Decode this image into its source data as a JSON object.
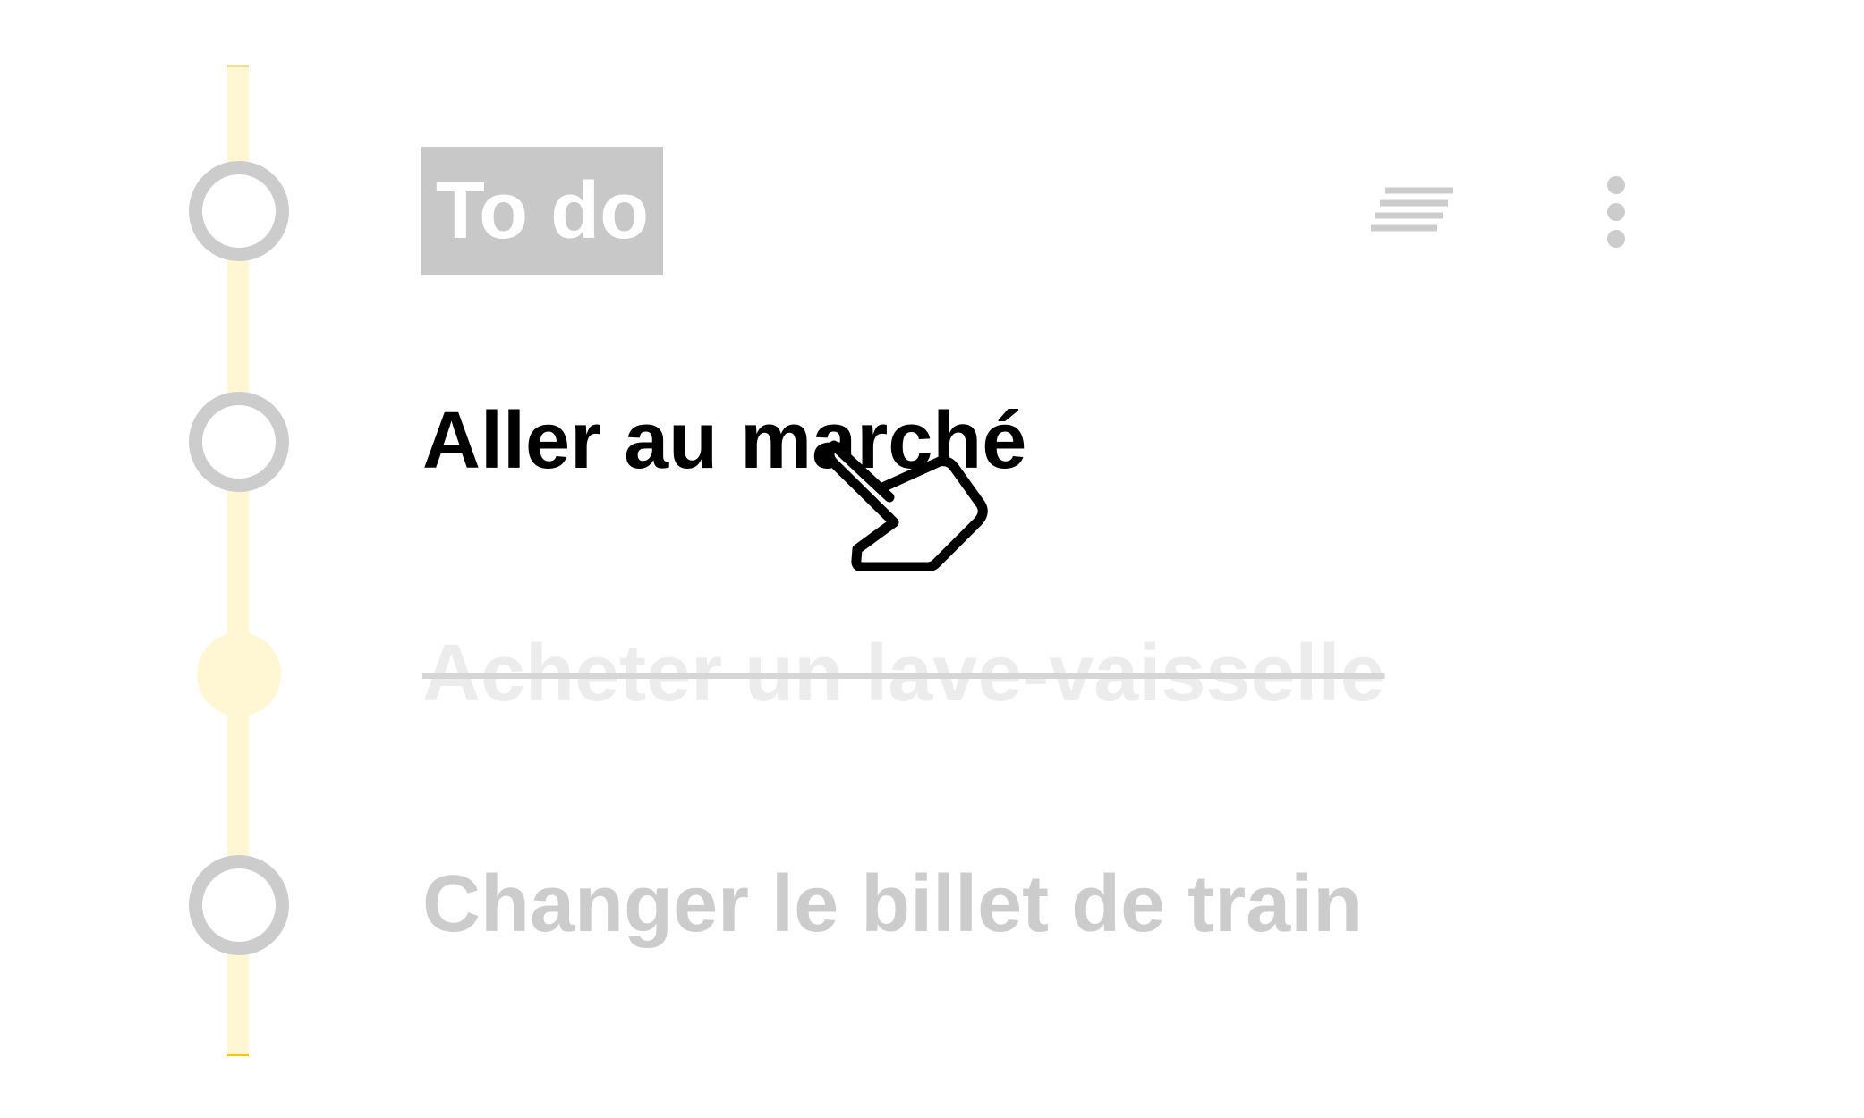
{
  "header": {
    "title": "To do",
    "sort_icon": "sort-lines-icon",
    "more_icon": "more-vertical-icon"
  },
  "tasks": [
    {
      "label": "Aller au marché",
      "state": "active"
    },
    {
      "label": "Acheter un lave-vaisselle",
      "state": "completed"
    },
    {
      "label": "Changer le billet de train",
      "state": "pending"
    }
  ],
  "cursor": {
    "icon": "hand-pointer-icon"
  },
  "colors": {
    "timeline_track": "#fff6d3",
    "timeline_accent": "#f2c81e",
    "ring": "#cccccc",
    "header_bg": "#c8c8c8",
    "active_text": "#000000",
    "muted_text": "#cccccc",
    "completed_text": "#ececec"
  }
}
